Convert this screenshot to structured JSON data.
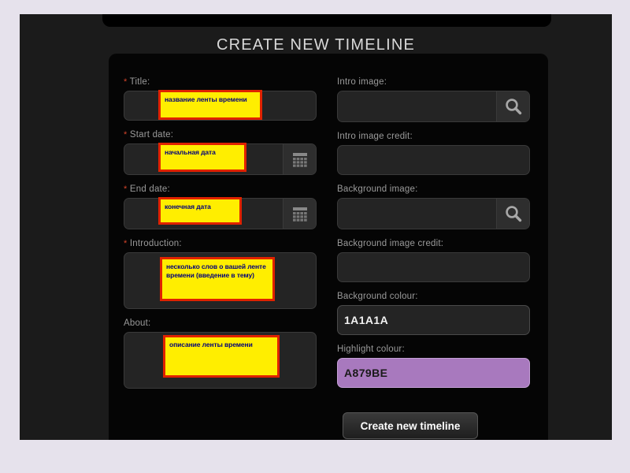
{
  "page": {
    "title": "CREATE NEW TIMELINE",
    "background_colour": "#e6e2ec",
    "panel_colour": "#050505",
    "container_colour": "#1b1b1b"
  },
  "form": {
    "left_column": [
      {
        "label": "Title:",
        "required": true,
        "required_marker": "*",
        "control": "text-input",
        "value": "",
        "annotation": "название ленты времени"
      },
      {
        "label": "Start date:",
        "required": true,
        "required_marker": "*",
        "control": "date-input",
        "value": "",
        "addon_icon": "calendar-icon",
        "annotation": "начальная дата"
      },
      {
        "label": "End date:",
        "required": true,
        "required_marker": "*",
        "control": "date-input",
        "value": "",
        "addon_icon": "calendar-icon",
        "annotation": "конечная дата"
      },
      {
        "label": "Introduction:",
        "required": true,
        "required_marker": "*",
        "control": "textarea",
        "value": "",
        "annotation": "несколько слов о вашей ленте времени (введение в тему)"
      },
      {
        "label": "About:",
        "required": false,
        "required_marker": "",
        "control": "textarea",
        "value": "",
        "annotation": "описание ленты времени"
      }
    ],
    "right_column": [
      {
        "label": "Intro image:",
        "control": "text-input-with-button",
        "value": "",
        "addon_icon": "search-icon"
      },
      {
        "label": "Intro image credit:",
        "control": "text-input",
        "value": ""
      },
      {
        "label": "Background image:",
        "control": "text-input-with-button",
        "value": "",
        "addon_icon": "search-icon"
      },
      {
        "label": "Background image credit:",
        "control": "text-input",
        "value": ""
      },
      {
        "label": "Background colour:",
        "control": "colour-input",
        "value": "1A1A1A",
        "swatch": "#1A1A1A"
      },
      {
        "label": "Highlight colour:",
        "control": "colour-input",
        "value": "A879BE",
        "swatch": "#A879BE"
      }
    ],
    "submit_button": "Create new timeline"
  },
  "annotation_style": {
    "fill": "#FFEE00",
    "border": "#E02200",
    "text": "#00007A"
  }
}
